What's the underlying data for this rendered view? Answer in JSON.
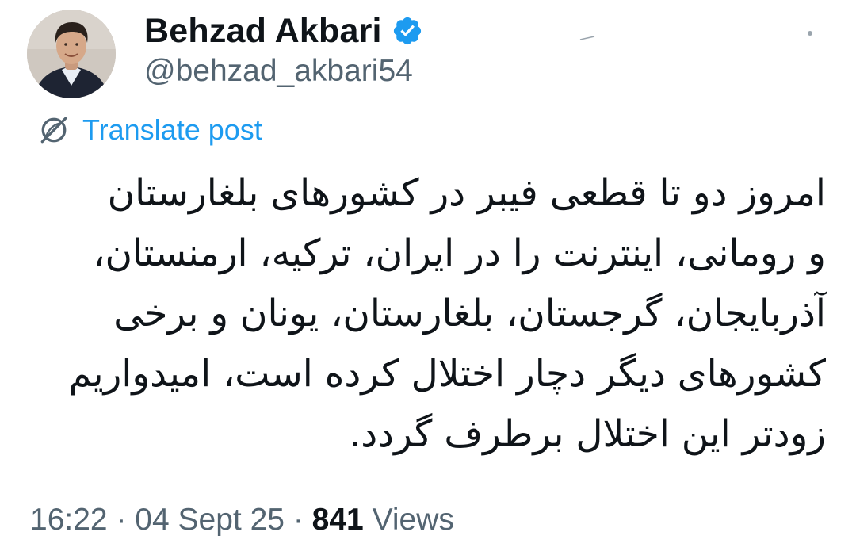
{
  "author": {
    "display_name": "Behzad Akbari",
    "handle": "@behzad_akbari54",
    "verified": true,
    "verified_color": "#1d9bf0"
  },
  "icons": {
    "verified": "verified-badge-icon",
    "translate": "translate-globe-icon",
    "more": "more-options-icon"
  },
  "translate": {
    "label": "Translate post",
    "color": "#1d9bf0"
  },
  "post": {
    "lines": [
      "امروز دو تا قطعی فیبر در کشورهای بلغارستان",
      "و رومانی، اینترنت را در ایران، ترکیه، ارمنستان،",
      "آذربایجان، گرجستان، بلغارستان، یونان و برخی",
      "کشورهای دیگر دچار اختلال کرده است، امیدواریم",
      "زودتر این اختلال برطرف گردد."
    ]
  },
  "meta": {
    "time": "16:22",
    "date": "04 Sept 25",
    "separator": "·",
    "views_count": "841",
    "views_label": "Views"
  }
}
